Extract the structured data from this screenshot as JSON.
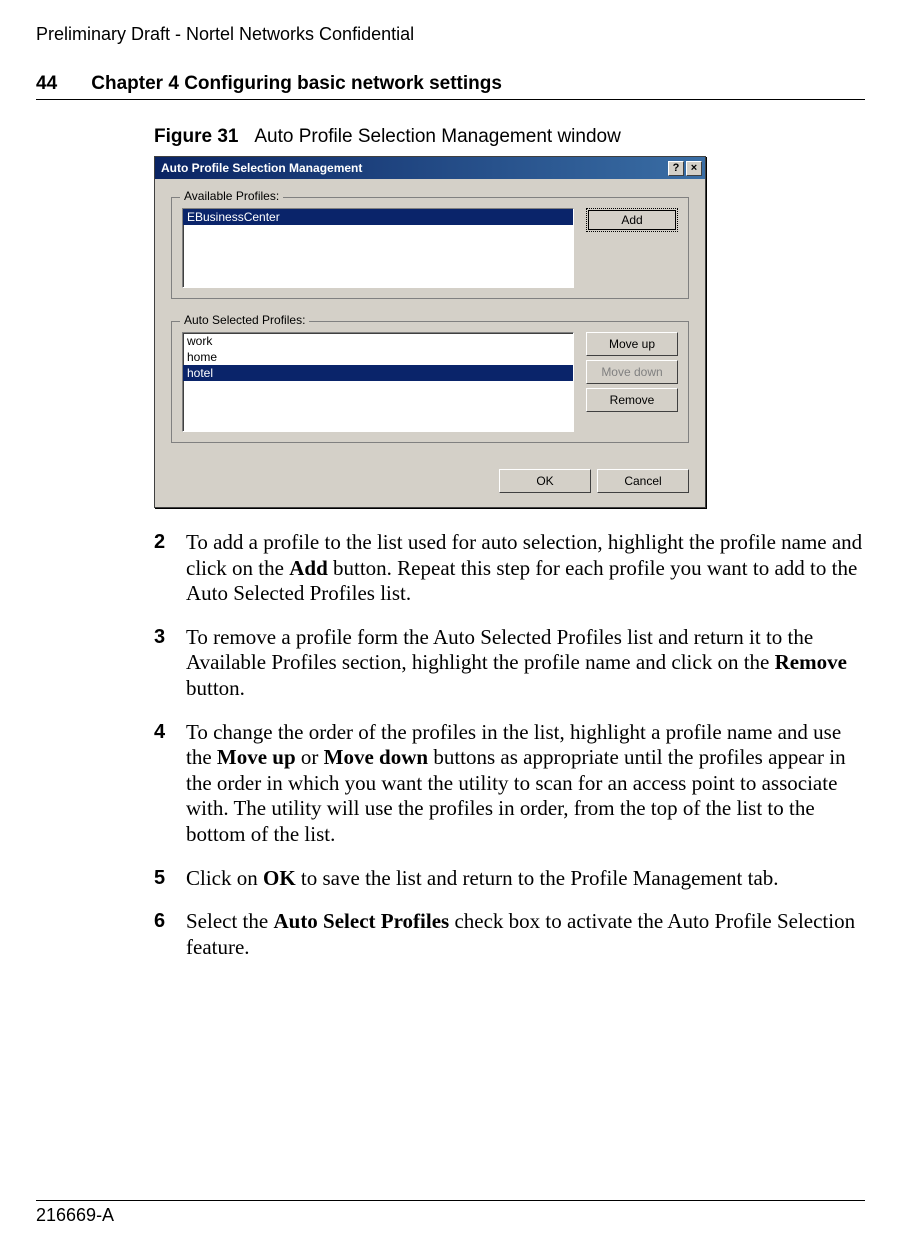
{
  "header": {
    "confidential": "Preliminary Draft - Nortel Networks Confidential",
    "page_number": "44",
    "chapter_title": "Chapter 4 Configuring basic network settings"
  },
  "figure": {
    "label": "Figure 31",
    "caption": "Auto Profile Selection Management window"
  },
  "dialog": {
    "title": "Auto Profile Selection Management",
    "help_btn": "?",
    "close_btn": "×",
    "available": {
      "legend": "Available Profiles:",
      "items": [
        "EBusinessCenter"
      ],
      "selected_index": 0,
      "add_btn": "Add"
    },
    "selected": {
      "legend": "Auto Selected Profiles:",
      "items": [
        "work",
        "home",
        "hotel"
      ],
      "selected_index": 2,
      "moveup_btn": "Move up",
      "movedown_btn": "Move down",
      "remove_btn": "Remove"
    },
    "ok_btn": "OK",
    "cancel_btn": "Cancel"
  },
  "steps": {
    "s2": {
      "num": "2",
      "pre": "To add a profile to the list used for auto selection, highlight the profile name and click on the ",
      "bold": "Add",
      "post": " button. Repeat this step for each profile you want to add to the Auto Selected Profiles list."
    },
    "s3": {
      "num": "3",
      "pre": "To remove a profile form the Auto Selected Profiles list and return it to the Available Profiles section, highlight the profile name and click on the ",
      "bold": "Remove",
      "post": " button."
    },
    "s4": {
      "num": "4",
      "pre": "To change the order of the profiles in the list, highlight a profile name and use the ",
      "bold1": "Move up",
      "mid": " or ",
      "bold2": "Move down",
      "post": " buttons as appropriate until the profiles appear in the order in which you want the utility to scan for an access point to associate with. The utility will use the profiles in order, from the top of the list to the bottom of the list."
    },
    "s5": {
      "num": "5",
      "pre": "Click on ",
      "bold": "OK",
      "post": " to save the list and return to the Profile Management tab."
    },
    "s6": {
      "num": "6",
      "pre": "Select the ",
      "bold": "Auto Select Profiles",
      "post": " check box to activate the Auto Profile Selection feature."
    }
  },
  "footer": {
    "docid": "216669-A"
  }
}
